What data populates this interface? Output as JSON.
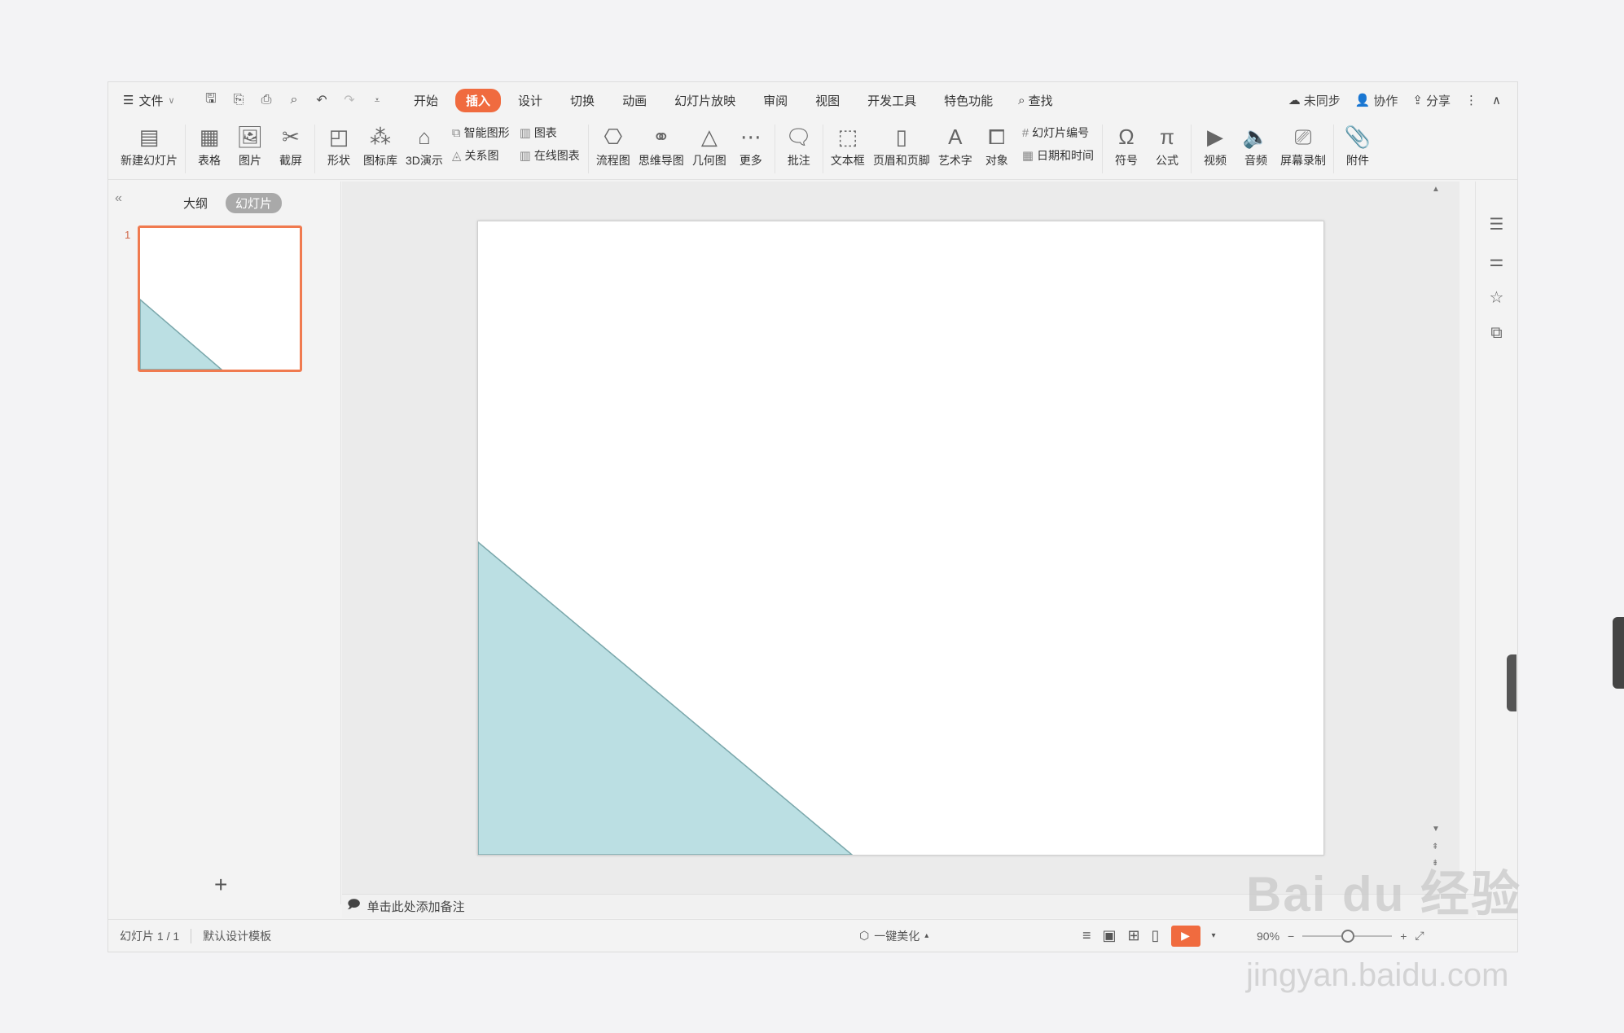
{
  "menubar": {
    "file_label": "文件",
    "tabs": [
      {
        "label": "开始",
        "active": false
      },
      {
        "label": "插入",
        "active": true
      },
      {
        "label": "设计",
        "active": false
      },
      {
        "label": "切换",
        "active": false
      },
      {
        "label": "动画",
        "active": false
      },
      {
        "label": "幻灯片放映",
        "active": false
      },
      {
        "label": "审阅",
        "active": false
      },
      {
        "label": "视图",
        "active": false
      },
      {
        "label": "开发工具",
        "active": false
      },
      {
        "label": "特色功能",
        "active": false
      }
    ],
    "search_label": "查找",
    "sync_label": "未同步",
    "collab_label": "协作",
    "share_label": "分享"
  },
  "ribbon": {
    "new_slide": "新建幻灯片",
    "table": "表格",
    "picture": "图片",
    "screenshot": "截屏",
    "shape": "形状",
    "icon_library": "图标库",
    "demo3d": "3D演示",
    "smart_art": "智能图形",
    "chart": "图表",
    "relation": "关系图",
    "online_chart": "在线图表",
    "flowchart": "流程图",
    "mindmap": "思维导图",
    "geometry": "几何图",
    "more": "更多",
    "comment": "批注",
    "textbox": "文本框",
    "header_footer": "页眉和页脚",
    "wordart": "艺术字",
    "object": "对象",
    "slide_number": "幻灯片编号",
    "date_time": "日期和时间",
    "symbol": "符号",
    "formula": "公式",
    "video": "视频",
    "audio": "音频",
    "screen_record": "屏幕录制",
    "attachment": "附件"
  },
  "leftpanel": {
    "outline_tab": "大纲",
    "slides_tab": "幻灯片",
    "slide_number": "1"
  },
  "slide": {
    "triangle_color": "#bbdfe3",
    "triangle_stroke": "#7aa7ab"
  },
  "notes": {
    "placeholder": "单击此处添加备注"
  },
  "statusbar": {
    "slide_count": "幻灯片 1 / 1",
    "template": "默认设计模板",
    "beautify": "一键美化",
    "zoom": "90%"
  },
  "colors": {
    "accent": "#f06b3f"
  },
  "watermark": {
    "brand": "Bai du 经验",
    "url": "jingyan.baidu.com"
  }
}
